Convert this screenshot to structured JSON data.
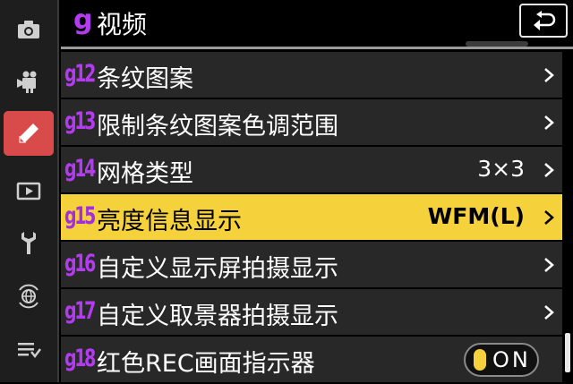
{
  "rail": {
    "items": [
      {
        "icon": "camera-icon"
      },
      {
        "icon": "movie-camera-icon"
      },
      {
        "icon": "pencil-icon",
        "active": true
      },
      {
        "icon": "playback-icon"
      },
      {
        "icon": "wrench-icon"
      },
      {
        "icon": "network-icon"
      },
      {
        "icon": "my-menu-icon"
      }
    ]
  },
  "header": {
    "letter": "g",
    "title": "视频",
    "back_icon": "back-arrow-icon"
  },
  "menu": {
    "rows": [
      {
        "code": "g12",
        "label": "条纹图案",
        "value": ""
      },
      {
        "code": "g13",
        "label": "限制条纹图案色调范围",
        "value": ""
      },
      {
        "code": "g14",
        "label": "网格类型",
        "value": "3×3"
      },
      {
        "code": "g15",
        "label": "亮度信息显示",
        "value": "WFM(L)"
      },
      {
        "code": "g16",
        "label": "自定义显示屏拍摄显示",
        "value": ""
      },
      {
        "code": "g17",
        "label": "自定义取景器拍摄显示",
        "value": ""
      },
      {
        "code": "g18",
        "label": "红色REC画面指示器",
        "toggle": "ON"
      }
    ]
  },
  "colors": {
    "accent_purple": "#b43cf0",
    "selected_yellow": "#f5d23c",
    "active_tab_red": "#d94b4b"
  }
}
